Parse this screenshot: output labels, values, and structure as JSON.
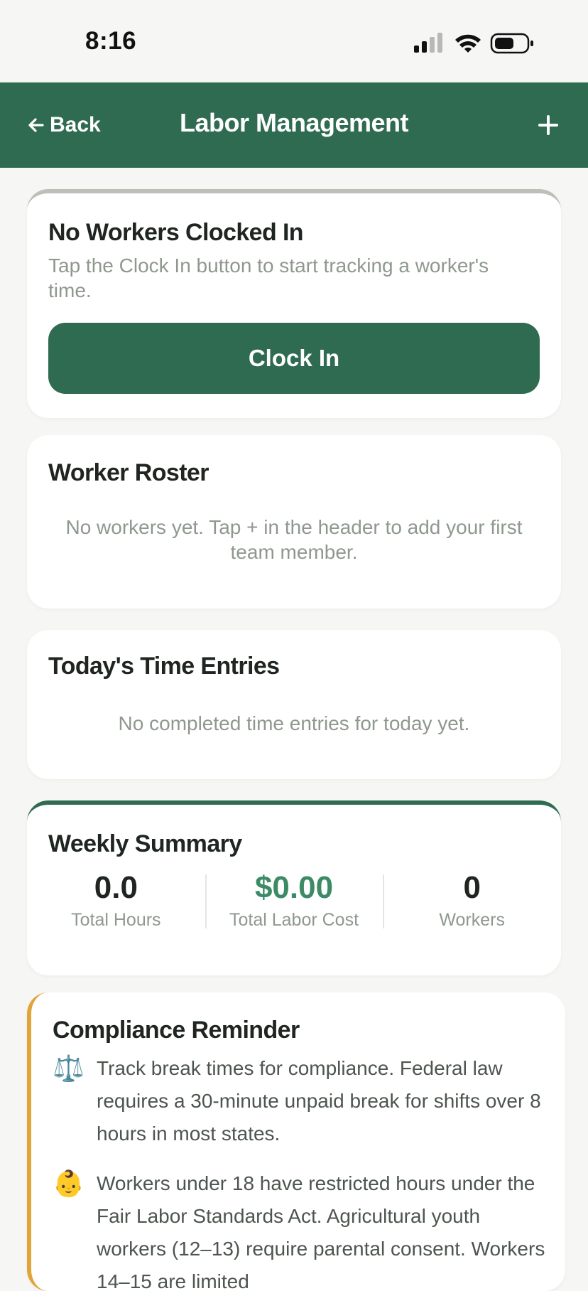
{
  "status_bar": {
    "time": "8:16"
  },
  "header": {
    "back_label": "Back",
    "title": "Labor Management",
    "add_label": "+"
  },
  "clock_card": {
    "title": "No Workers Clocked In",
    "subtitle": "Tap the Clock In button to start tracking a worker's time.",
    "button_label": "Clock In"
  },
  "roster_card": {
    "title": "Worker Roster",
    "empty_text": "No workers yet. Tap + in the header to add your first team member."
  },
  "entries_card": {
    "title": "Today's Time Entries",
    "empty_text": "No completed time entries for today yet."
  },
  "summary_card": {
    "title": "Weekly Summary",
    "stats": [
      {
        "value": "0.0",
        "label": "Total Hours"
      },
      {
        "value": "$0.00",
        "label": "Total Labor Cost"
      },
      {
        "value": "0",
        "label": "Workers"
      }
    ]
  },
  "compliance_card": {
    "title": "Compliance Reminder",
    "tips": [
      {
        "icon": "⚖️",
        "text": "Track break times for compliance. Federal law requires a 30-minute unpaid break for shifts over 8 hours in most states."
      },
      {
        "icon": "👶",
        "text": "Workers under 18 have restricted hours under the Fair Labor Standards Act. Agricultural youth workers (12–13) require parental consent. Workers 14–15 are limited"
      }
    ]
  },
  "colors": {
    "brand_green": "#2f6b50",
    "money_green": "#3d8a66",
    "compliance_accent": "#e0a43a",
    "background": "#f6f7f4"
  }
}
